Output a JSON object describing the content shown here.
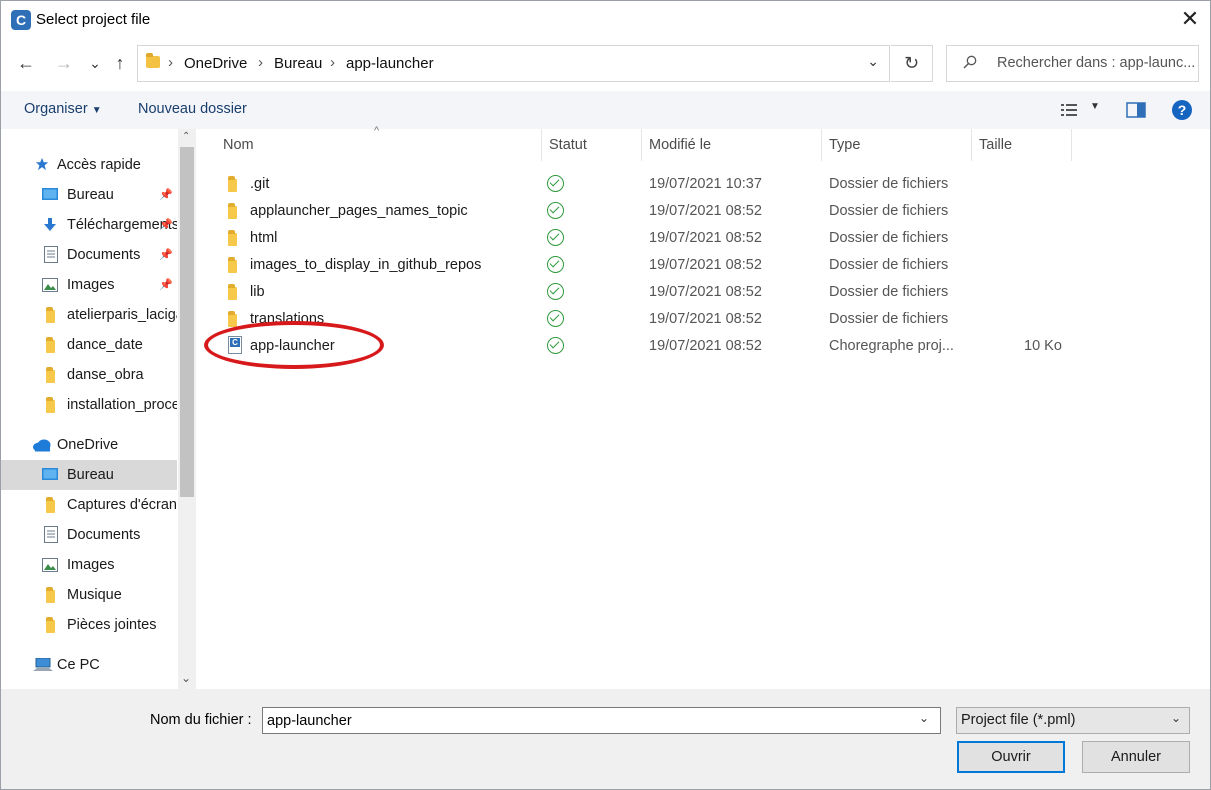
{
  "window": {
    "title": "Select project file",
    "app_icon_letter": "C"
  },
  "nav": {
    "back": "←",
    "forward": "→",
    "recent": "⌄",
    "up": "↑",
    "refresh": "↻",
    "addr_dropdown": "⌄"
  },
  "address": {
    "crumbs": [
      "OneDrive",
      "Bureau",
      "app-launcher"
    ]
  },
  "search": {
    "placeholder": "Rechercher dans : app-launc..."
  },
  "toolbar": {
    "organize": "Organiser",
    "new_folder": "Nouveau dossier"
  },
  "sidebar": {
    "items": [
      {
        "label": "Accès rapide",
        "icon": "star-icon",
        "pinned": false
      },
      {
        "label": "Bureau",
        "icon": "desktop-icon",
        "pinned": true
      },
      {
        "label": "Téléchargements",
        "icon": "download-icon",
        "pinned": true
      },
      {
        "label": "Documents",
        "icon": "document-icon",
        "pinned": true
      },
      {
        "label": "Images",
        "icon": "image-icon",
        "pinned": true
      },
      {
        "label": "atelierparis_lacigale",
        "icon": "folder-icon",
        "pinned": false
      },
      {
        "label": "dance_date",
        "icon": "folder-icon",
        "pinned": false
      },
      {
        "label": "danse_obra",
        "icon": "folder-icon",
        "pinned": false
      },
      {
        "label": "installation_process",
        "icon": "folder-icon",
        "pinned": false
      },
      {
        "label": "OneDrive",
        "icon": "cloud-icon",
        "pinned": false
      },
      {
        "label": "Bureau",
        "icon": "desktop-icon",
        "pinned": false,
        "selected": true
      },
      {
        "label": "Captures d'écran",
        "icon": "folder-icon",
        "pinned": false
      },
      {
        "label": "Documents",
        "icon": "document-icon",
        "pinned": false
      },
      {
        "label": "Images",
        "icon": "image-icon",
        "pinned": false
      },
      {
        "label": "Musique",
        "icon": "folder-icon",
        "pinned": false
      },
      {
        "label": "Pièces jointes",
        "icon": "folder-icon",
        "pinned": false
      },
      {
        "label": "Ce PC",
        "icon": "computer-icon",
        "pinned": false
      }
    ]
  },
  "columns": {
    "name": "Nom",
    "status": "Statut",
    "modified": "Modifié le",
    "type": "Type",
    "size": "Taille"
  },
  "files": [
    {
      "name": ".git",
      "modified": "19/07/2021 10:37",
      "type": "Dossier de fichiers",
      "size": "",
      "kind": "folder"
    },
    {
      "name": "applauncher_pages_names_topic",
      "modified": "19/07/2021 08:52",
      "type": "Dossier de fichiers",
      "size": "",
      "kind": "folder"
    },
    {
      "name": "html",
      "modified": "19/07/2021 08:52",
      "type": "Dossier de fichiers",
      "size": "",
      "kind": "folder"
    },
    {
      "name": "images_to_display_in_github_repos",
      "modified": "19/07/2021 08:52",
      "type": "Dossier de fichiers",
      "size": "",
      "kind": "folder"
    },
    {
      "name": "lib",
      "modified": "19/07/2021 08:52",
      "type": "Dossier de fichiers",
      "size": "",
      "kind": "folder"
    },
    {
      "name": "translations",
      "modified": "19/07/2021 08:52",
      "type": "Dossier de fichiers",
      "size": "",
      "kind": "folder"
    },
    {
      "name": "app-launcher",
      "modified": "19/07/2021 08:52",
      "type": "Choregraphe proj...",
      "size": "10 Ko",
      "kind": "pml"
    }
  ],
  "bottom": {
    "filename_label": "Nom du fichier :",
    "filename_value": "app-launcher",
    "filetype": "Project file (*.pml)",
    "open": "Ouvrir",
    "cancel": "Annuler"
  },
  "colors": {
    "accent": "#0078d7",
    "highlight_ring": "#d7191c",
    "status_ok": "#2f9a3c",
    "folder": "#f6c94a"
  }
}
